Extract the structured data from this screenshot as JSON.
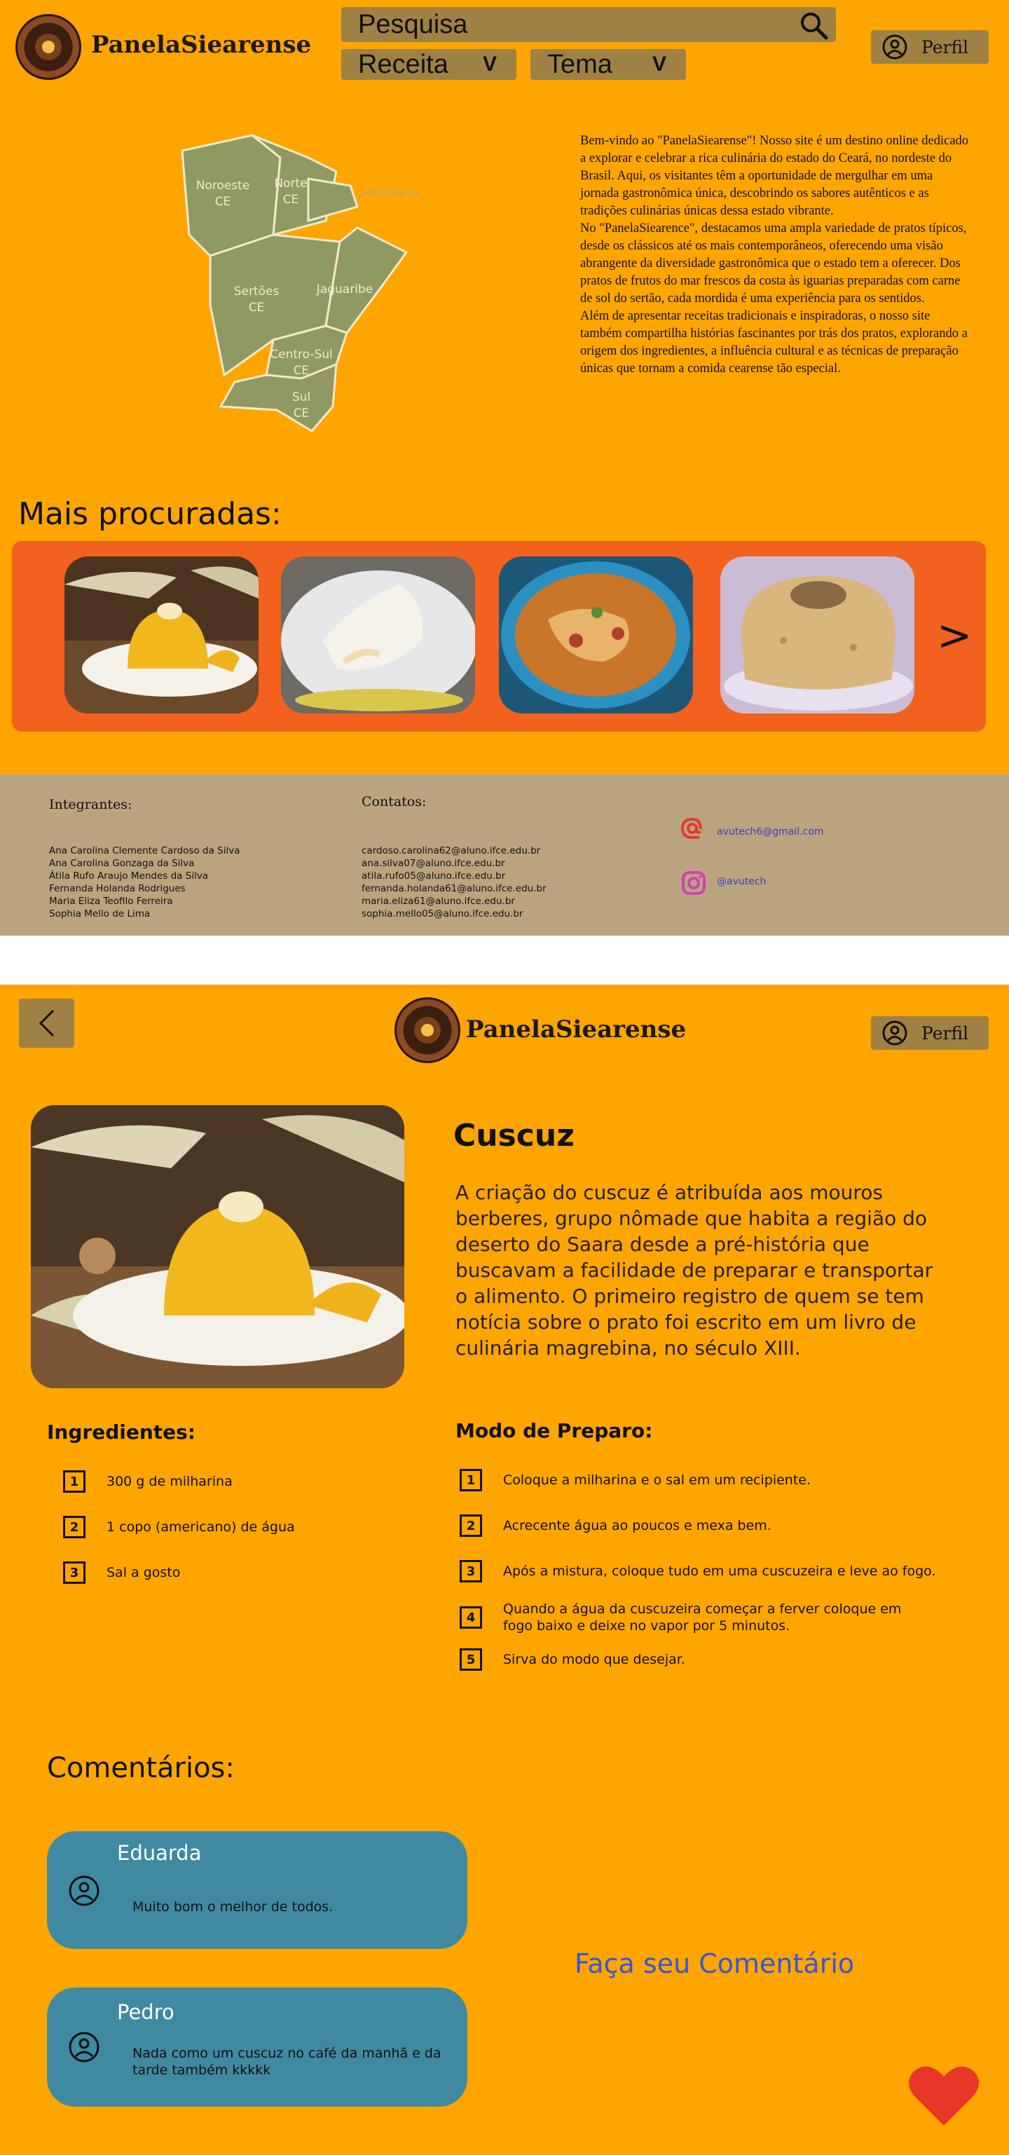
{
  "home": {
    "logo_text": "PanelaSiearense",
    "search": {
      "placeholder": "Pesquisa"
    },
    "dropdowns": [
      {
        "label": "Receita",
        "chevron": "V"
      },
      {
        "label": "Tema",
        "chevron": "V"
      }
    ],
    "profile_label": "Perfil",
    "map": {
      "regions": [
        {
          "name": "Noroeste",
          "suffix": "CE"
        },
        {
          "name": "Norte",
          "suffix": "CE"
        },
        {
          "name": "Fortaleza",
          "suffix": ""
        },
        {
          "name": "Sertões",
          "suffix": "CE"
        },
        {
          "name": "Jaguaribe",
          "suffix": ""
        },
        {
          "name": "Centro-Sul",
          "suffix": "CE"
        },
        {
          "name": "Sul",
          "suffix": "CE"
        }
      ]
    },
    "intro_paragraphs": [
      "Bem-vindo ao \"PanelaSiearense\"! Nosso site é um destino online dedicado a explorar e celebrar a rica culinária do estado do Ceará, no nordeste do Brasil. Aqui, os visitantes têm a oportunidade de mergulhar em uma jornada gastronômica única, descobrindo os sabores autênticos e as tradições culinárias únicas dessa estado vibrante.",
      "No \"PanelaSiearence\", destacamos uma ampla variedade de pratos típicos, desde os clássicos até os mais contemporâneos, oferecendo uma visão abrangente da diversidade gastronômica que o estado tem a oferecer. Dos pratos de frutos do mar frescos da costa às iguarias preparadas com carne de sol do sertão, cada mordida é uma experiência para os sentidos.",
      "Além de apresentar receitas tradicionais e inspiradoras, o nosso site também compartilha histórias fascinantes por trás dos pratos, explorando a origem dos ingredientes, a influência cultural e as técnicas de preparação únicas que tornam a comida cearense tão especial."
    ],
    "popular_title": "Mais procuradas:",
    "carousel_next": ">",
    "footer": {
      "members_title": "Integrantes:",
      "members": [
        "Ana Carolina Clemente Cardoso da Silva",
        "Ana Carolina Gonzaga da Silva",
        "Átila Rufo Araujo Mendes da Silva",
        "Fernanda Holanda Rodrigues",
        "Maria Eliza Teofilo Ferreira",
        "Sophia Mello de Lima"
      ],
      "contacts_title": "Contatos:",
      "contacts": [
        "cardoso.carolina62@aluno.ifce.edu.br",
        "ana.silva07@aluno.ifce.edu.br",
        "atila.rufo05@aluno.ifce.edu.br",
        "fernanda.holanda61@aluno.ifce.edu.br",
        "maria.eliza61@aluno.ifce.edu.br",
        "sophia.mello05@aluno.ifce.edu.br"
      ],
      "email": "avutech6@gmail.com",
      "instagram": "@avutech"
    }
  },
  "recipe": {
    "logo_text": "PanelaSiearense",
    "profile_label": "Perfil",
    "title": "Cuscuz",
    "description": "A criação do cuscuz é atribuída aos mouros berberes, grupo nômade que habita a região do deserto do Saara desde a pré-história que buscavam a facilidade de preparar e transportar o alimento. O primeiro registro de quem se tem notícia sobre o prato foi escrito em um livro de culinária magrebina, no século XIII.",
    "ingredients_title": "Ingredientes:",
    "ingredients": [
      {
        "n": "1",
        "text": "300 g de milharina"
      },
      {
        "n": "2",
        "text": "1 copo (americano) de água"
      },
      {
        "n": "3",
        "text": "Sal a gosto"
      }
    ],
    "steps_title": "Modo de Preparo:",
    "steps": [
      {
        "n": "1",
        "text": "Coloque a milharina e o sal em um recipiente."
      },
      {
        "n": "2",
        "text": "Acrecente água ao poucos e mexa bem."
      },
      {
        "n": "3",
        "text": "Após a mistura, coloque tudo em uma cuscuzeira e leve ao fogo."
      },
      {
        "n": "4",
        "text": "Quando a água da cuscuzeira começar a ferver coloque em fogo baixo e deixe no vapor por 5 minutos."
      },
      {
        "n": "5",
        "text": "Sirva do modo que desejar."
      }
    ],
    "comments_title": "Comentários:",
    "comments": [
      {
        "name": "Eduarda",
        "text": "Muito bom o melhor de todos."
      },
      {
        "name": "Pedro",
        "text": "Nada como um cuscuz no café da manhã e da tarde também kkkkk"
      }
    ],
    "comment_cta": "Faça seu Comentário"
  }
}
